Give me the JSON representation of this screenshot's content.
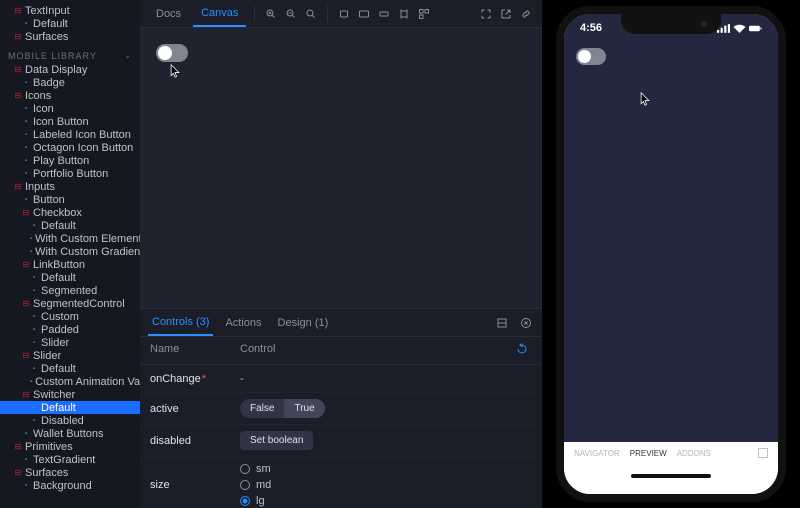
{
  "sidebar": {
    "top_items": [
      {
        "label": "TextInput",
        "icon": "minus",
        "lvl": 1
      },
      {
        "label": "Default",
        "icon": "sq",
        "lvl": 2
      },
      {
        "label": "Surfaces",
        "icon": "minus",
        "lvl": 1
      }
    ],
    "section_title": "MOBILE LIBRARY",
    "groups": [
      {
        "label": "Data Display",
        "children": [
          {
            "label": "Badge"
          }
        ]
      },
      {
        "label": "Icons",
        "children": [
          {
            "label": "Icon"
          },
          {
            "label": "Icon Button"
          },
          {
            "label": "Labeled Icon Button"
          },
          {
            "label": "Octagon Icon Button"
          },
          {
            "label": "Play Button"
          },
          {
            "label": "Portfolio Button"
          }
        ]
      },
      {
        "label": "Inputs",
        "children": [
          {
            "label": "Button"
          },
          {
            "label": "Checkbox",
            "sub": [
              {
                "label": "Default"
              },
              {
                "label": "With Custom Element"
              },
              {
                "label": "With Custom Gradient"
              }
            ]
          },
          {
            "label": "LinkButton",
            "sub": [
              {
                "label": "Default"
              },
              {
                "label": "Segmented"
              }
            ]
          },
          {
            "label": "SegmentedControl",
            "sub": [
              {
                "label": "Custom"
              },
              {
                "label": "Padded"
              },
              {
                "label": "Slider"
              }
            ]
          },
          {
            "label": "Slider",
            "sub": [
              {
                "label": "Default"
              },
              {
                "label": "Custom Animation Value"
              }
            ]
          },
          {
            "label": "Switcher",
            "sub": [
              {
                "label": "Default",
                "active": true
              },
              {
                "label": "Disabled"
              }
            ]
          },
          {
            "label": "Wallet Buttons"
          }
        ]
      },
      {
        "label": "Primitives",
        "children": [
          {
            "label": "TextGradient"
          }
        ]
      },
      {
        "label": "Surfaces",
        "children": [
          {
            "label": "Background"
          }
        ]
      }
    ]
  },
  "toolbar": {
    "tabs": [
      {
        "label": "Docs"
      },
      {
        "label": "Canvas",
        "active": true
      }
    ]
  },
  "panel": {
    "tabs": [
      {
        "label": "Controls (3)",
        "active": true
      },
      {
        "label": "Actions"
      },
      {
        "label": "Design (1)"
      }
    ],
    "head": {
      "name": "Name",
      "control": "Control"
    },
    "rows": [
      {
        "name": "onChange",
        "required": true,
        "type": "dash",
        "value": "-"
      },
      {
        "name": "active",
        "type": "segmented",
        "options": [
          "False",
          "True"
        ],
        "selected": "True"
      },
      {
        "name": "disabled",
        "type": "button",
        "value": "Set boolean"
      },
      {
        "name": "size",
        "type": "radio",
        "options": [
          "sm",
          "md",
          "lg"
        ],
        "selected": "lg"
      }
    ]
  },
  "device": {
    "time": "4:56",
    "bottom_tabs": [
      {
        "label": "NAVIGATOR"
      },
      {
        "label": "PREVIEW",
        "active": true
      },
      {
        "label": "ADDONS"
      }
    ]
  }
}
